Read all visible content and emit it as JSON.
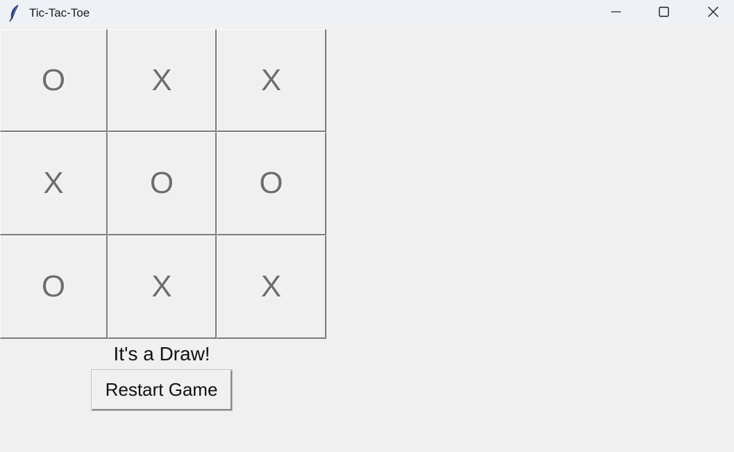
{
  "window": {
    "title": "Tic-Tac-Toe",
    "icon": "feather-icon",
    "controls": [
      "minimize-icon",
      "maximize-icon",
      "close-icon"
    ]
  },
  "board": {
    "cells": [
      "O",
      "X",
      "X",
      "X",
      "O",
      "O",
      "O",
      "X",
      "X"
    ]
  },
  "status": "It's a Draw!",
  "restart_label": "Restart Game",
  "colors": {
    "background": "#f0f0f0",
    "titlebar": "#eef2f7",
    "mark": "#6e6e6e",
    "cell_shadow": "#7a7a7a"
  }
}
